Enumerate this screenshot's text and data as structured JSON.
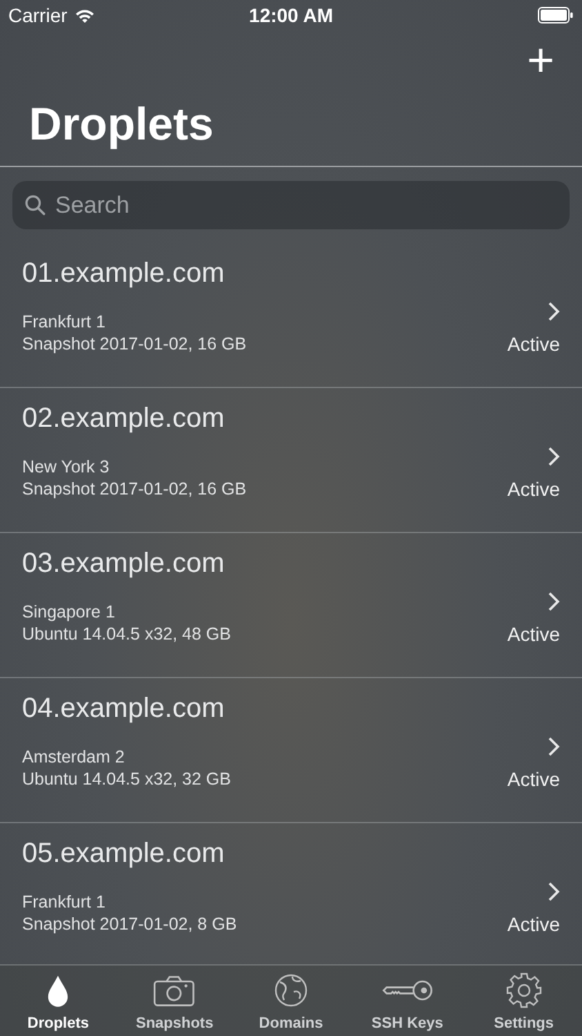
{
  "status_bar": {
    "carrier": "Carrier",
    "time": "12:00 AM"
  },
  "nav": {
    "add_label": "+",
    "title": "Droplets"
  },
  "search": {
    "placeholder": "Search"
  },
  "droplets": [
    {
      "name": "01.example.com",
      "region": "Frankfurt 1",
      "image": "Snapshot 2017-01-02, 16 GB",
      "status": "Active"
    },
    {
      "name": "02.example.com",
      "region": "New York 3",
      "image": "Snapshot 2017-01-02, 16 GB",
      "status": "Active"
    },
    {
      "name": "03.example.com",
      "region": "Singapore 1",
      "image": "Ubuntu 14.04.5 x32, 48 GB",
      "status": "Active"
    },
    {
      "name": "04.example.com",
      "region": "Amsterdam 2",
      "image": "Ubuntu 14.04.5 x32, 32 GB",
      "status": "Active"
    },
    {
      "name": "05.example.com",
      "region": "Frankfurt 1",
      "image": "Snapshot 2017-01-02, 8 GB",
      "status": "Active"
    }
  ],
  "tabs": [
    {
      "kind": "droplet",
      "label": "Droplets",
      "selected": true
    },
    {
      "kind": "camera",
      "label": "Snapshots",
      "selected": false
    },
    {
      "kind": "globe",
      "label": "Domains",
      "selected": false
    },
    {
      "kind": "key",
      "label": "SSH Keys",
      "selected": false
    },
    {
      "kind": "gear",
      "label": "Settings",
      "selected": false
    }
  ]
}
